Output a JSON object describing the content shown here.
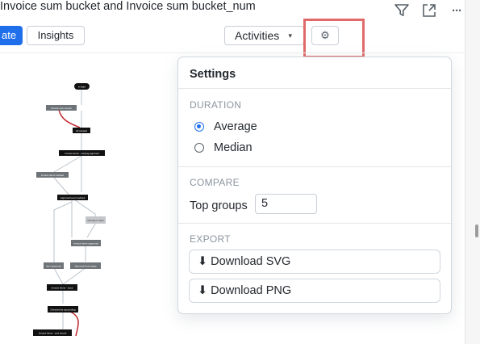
{
  "header": {
    "title": "Invoice sum bucket and Invoice sum bucket_num",
    "filter_icon": "filter-icon",
    "expand_icon": "expand-icon",
    "more_icon": "more-icon",
    "more_label": "···"
  },
  "toolbar": {
    "primary_label": "ate",
    "insights_label": "Insights",
    "activities_label": "Activities",
    "activities_caret": "▾",
    "settings_icon": "gear-icon",
    "settings_glyph": "⚙",
    "highlight_color": "#e06a6a",
    "accent": "#1f6feb"
  },
  "graph": {
    "nodes": [
      "● Start",
      "Invoice sum bucket",
      "All created",
      "Invoice items - varying approval",
      "Invoice items created",
      "Approval level reached",
      "Changes made",
      "Invoice items approved",
      "Item approved",
      "Approval level stage",
      "Invoice items - input",
      "Checked by accounting",
      "Invoice items - end record"
    ]
  },
  "settings": {
    "title": "Settings",
    "duration": {
      "label": "DURATION",
      "options": [
        "Average",
        "Median"
      ],
      "selected": "Average"
    },
    "compare": {
      "label": "COMPARE",
      "top_groups_label": "Top groups",
      "top_groups_value": "5"
    },
    "export": {
      "label": "EXPORT",
      "download_svg": "⬇ Download SVG",
      "download_png": "⬇ Download PNG"
    }
  }
}
